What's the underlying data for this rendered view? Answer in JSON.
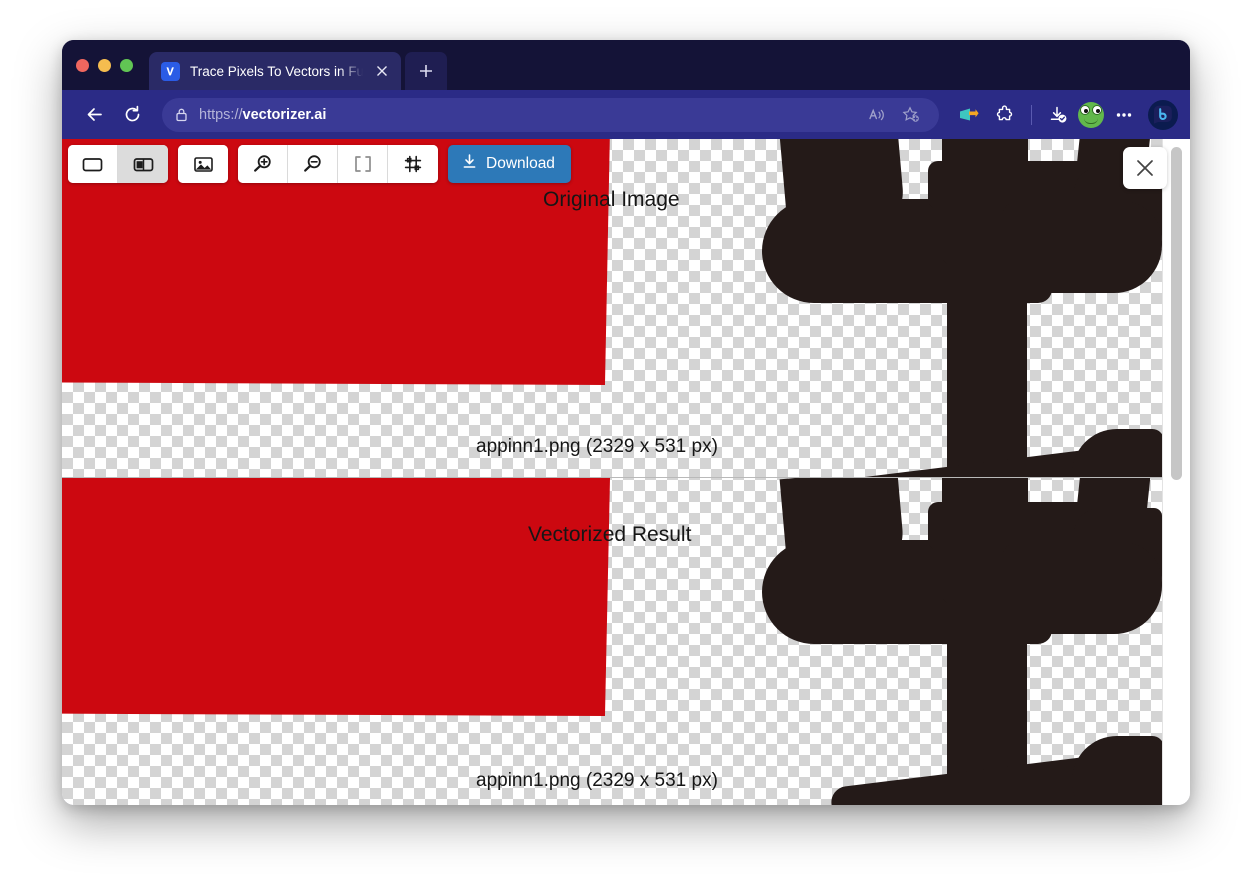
{
  "window": {
    "traffic_lights": [
      "close",
      "minimize",
      "zoom"
    ]
  },
  "tab": {
    "title": "Trace Pixels To Vectors in Full C",
    "favicon_icon": "vectorizer-v-icon",
    "close_icon": "close-icon",
    "new_tab_icon": "plus-icon"
  },
  "navbar": {
    "back_icon": "arrow-left-icon",
    "reload_icon": "reload-icon",
    "lock_icon": "lock-icon",
    "url_scheme": "https://",
    "url_host": "vectorizer.ai",
    "read_aloud_icon": "read-aloud-icon",
    "favorite_icon": "star-add-icon",
    "collections_icon": "collections-icon",
    "extensions_icon": "puzzle-piece-icon",
    "downloads_icon": "download-complete-icon",
    "profile_icon": "frog-avatar-icon",
    "settings_icon": "more-ellipsis-icon",
    "copilot_icon": "copilot-icon"
  },
  "app_toolbar": {
    "single_view_icon": "single-pane-icon",
    "split_view_icon": "split-pane-icon",
    "image_icon": "image-icon",
    "zoom_in_icon": "zoom-in-icon",
    "zoom_out_icon": "zoom-out-icon",
    "fit_screen_icon": "fit-to-screen-icon",
    "transform_icon": "transform-grid-icon",
    "download_label": "Download",
    "download_icon": "download-arrow-icon",
    "close_icon": "close-icon"
  },
  "panes": {
    "top": {
      "label": "Original Image",
      "filename": "appinn1.png (2329 x 531 px)"
    },
    "bottom": {
      "label": "Vectorized Result",
      "filename": "appinn1.png (2329 x 531 px)"
    }
  },
  "colors": {
    "artwork_red": "#cc0810",
    "artwork_dark": "#241a18",
    "download_blue": "#2d79b8",
    "browser_chrome": "#2b2b86",
    "tabstrip": "#141337"
  }
}
